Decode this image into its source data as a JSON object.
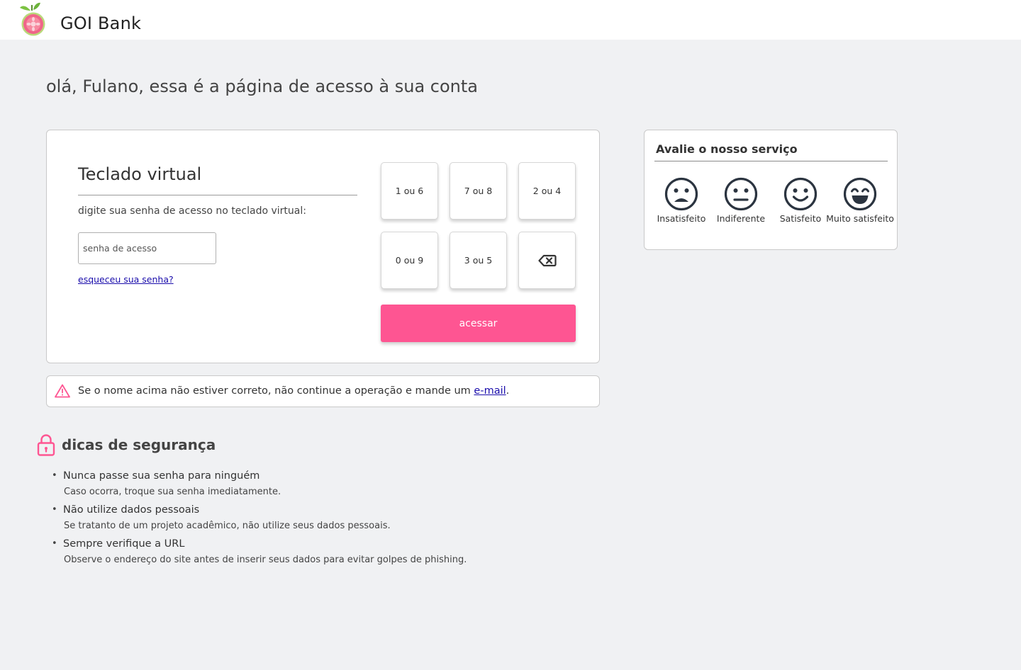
{
  "header": {
    "brand": "GOI Bank",
    "logo_icon": "guava-fruit-logo"
  },
  "greeting": "olá, Fulano, essa é a página de acesso à sua conta",
  "login": {
    "title": "Teclado virtual",
    "instruction": "digite sua senha de acesso no teclado virtual:",
    "password_placeholder": "senha de acesso",
    "forgot_link": "esqueceu sua senha?",
    "keys": [
      "1 ou 6",
      "7 ou 8",
      "2 ou 4",
      "0 ou 9",
      "3 ou 5"
    ],
    "backspace_icon": "backspace-icon",
    "submit_label": "acessar"
  },
  "warning": {
    "icon": "warning-triangle-icon",
    "text_before": "Se o nome acima não estiver correto, não continue a operação e mande um ",
    "link_text": "e-mail",
    "text_after": "."
  },
  "rating": {
    "title": "Avalie o nosso serviço",
    "options": [
      {
        "label": "Insatisfeito",
        "icon": "sad-face-icon"
      },
      {
        "label": "Indiferente",
        "icon": "neutral-face-icon"
      },
      {
        "label": "Satisfeito",
        "icon": "smile-face-icon"
      },
      {
        "label": "Muito satisfeito",
        "icon": "laughing-face-icon"
      }
    ]
  },
  "tips": {
    "icon": "lock-icon",
    "title": "dicas de segurança",
    "items": [
      {
        "title": "Nunca passe sua senha para ninguém",
        "description": "Caso ocorra, troque sua senha imediatamente."
      },
      {
        "title": "Não utilize dados pessoais",
        "description": "Se tratanto de um projeto acadêmico, não utilize seus dados pessoais."
      },
      {
        "title": "Sempre verifique a URL",
        "description": "Observe o endereço do site antes de inserir seus dados para evitar golpes de phishing."
      }
    ]
  },
  "colors": {
    "accent": "#fe5592",
    "background": "#f0f1f3",
    "link": "#1a0dab",
    "icon_dark": "#2b3440"
  }
}
